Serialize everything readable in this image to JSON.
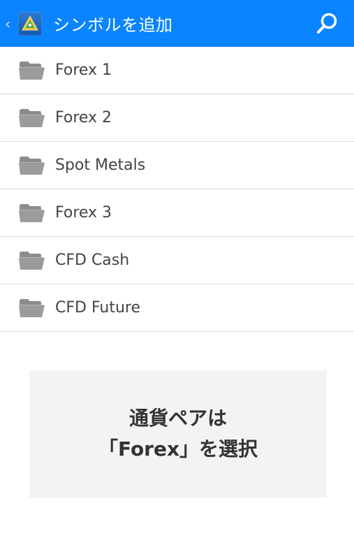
{
  "header": {
    "back_icon": "chevron-left-icon",
    "app_icon": "metatrader-app-icon",
    "title": "シンボルを追加",
    "search_icon": "search-icon",
    "background_color": "#0a84ff"
  },
  "symbol_groups": {
    "items": [
      {
        "label": "Forex 1",
        "icon": "folder-icon"
      },
      {
        "label": "Forex 2",
        "icon": "folder-icon"
      },
      {
        "label": "Spot Metals",
        "icon": "folder-icon"
      },
      {
        "label": "Forex 3",
        "icon": "folder-icon"
      },
      {
        "label": "CFD Cash",
        "icon": "folder-icon"
      },
      {
        "label": "CFD Future",
        "icon": "folder-icon"
      }
    ]
  },
  "notice": {
    "line1": "通貨ペアは",
    "line2": "「Forex」を選択"
  }
}
